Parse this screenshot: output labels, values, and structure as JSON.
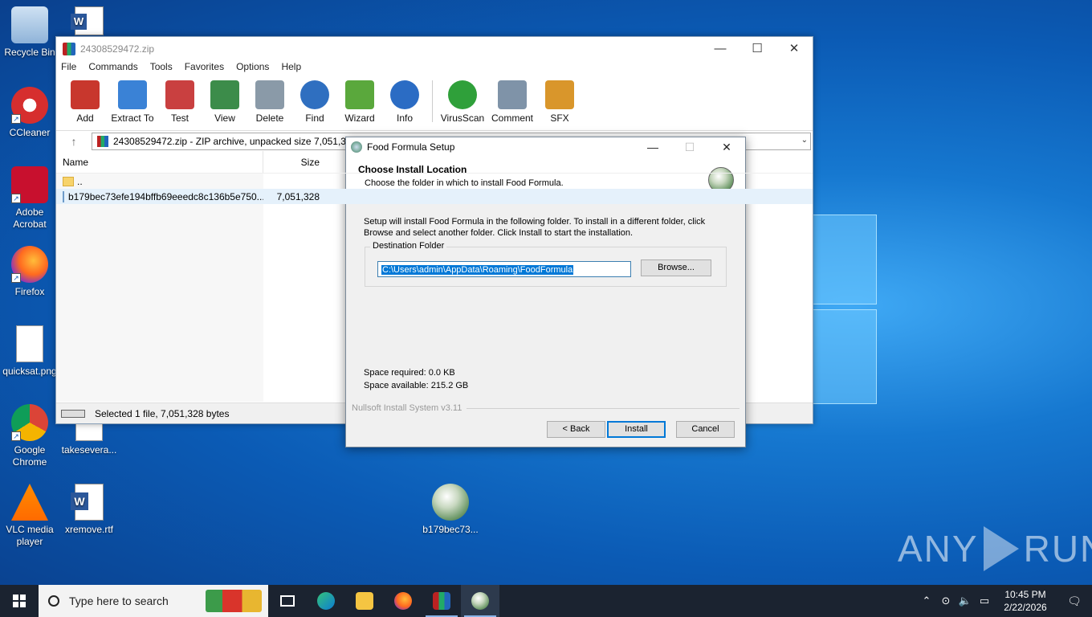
{
  "desktop": {
    "icons": [
      {
        "label": "Recycle Bin",
        "icon": "recycle-bin-icon"
      },
      {
        "label": "CCleaner",
        "icon": "ccleaner-icon"
      },
      {
        "label": "Adobe Acrobat",
        "icon": "acrobat-icon"
      },
      {
        "label": "Firefox",
        "icon": "firefox-icon"
      },
      {
        "label": "quicksat.png",
        "icon": "image-file-icon"
      },
      {
        "label": "Google Chrome",
        "icon": "chrome-icon"
      },
      {
        "label": "VLC media player",
        "icon": "vlc-icon"
      },
      {
        "label": "takesevera...",
        "icon": "image-file-icon"
      },
      {
        "label": "xremove.rtf",
        "icon": "word-document-icon"
      },
      {
        "label": "b179bec73...",
        "icon": "nsis-installer-icon"
      }
    ]
  },
  "winrar": {
    "title": "24308529472.zip",
    "menu": [
      "File",
      "Commands",
      "Tools",
      "Favorites",
      "Options",
      "Help"
    ],
    "toolbar": [
      {
        "label": "Add",
        "color": "#c8372d"
      },
      {
        "label": "Extract To",
        "color": "#3a82d6"
      },
      {
        "label": "Test",
        "color": "#c94040"
      },
      {
        "label": "View",
        "color": "#3c8c4a"
      },
      {
        "label": "Delete",
        "color": "#8a9aa8"
      },
      {
        "label": "Find",
        "color": "#2f6fc0"
      },
      {
        "label": "Wizard",
        "color": "#5aa83c"
      },
      {
        "label": "Info",
        "color": "#2b6cc4"
      },
      {
        "label": "VirusScan",
        "color": "#2fa03a"
      },
      {
        "label": "Comment",
        "color": "#7f93a8"
      },
      {
        "label": "SFX",
        "color": "#d9962b"
      }
    ],
    "path": "24308529472.zip - ZIP archive, unpacked size 7,051,328",
    "columns": {
      "name": "Name",
      "size": "Size"
    },
    "rows": [
      {
        "name": "..",
        "size": ""
      },
      {
        "name": "b179bec73efe194bffb69eeedc8c136b5e750...",
        "size": "7,051,328"
      }
    ],
    "status": "Selected 1 file, 7,051,328 bytes"
  },
  "setup": {
    "title": "Food Formula Setup",
    "heading": "Choose Install Location",
    "subheading": "Choose the folder in which to install Food Formula.",
    "description": "Setup will install Food Formula in the following folder. To install in a different folder, click Browse and select another folder. Click Install to start the installation.",
    "dest_label": "Destination Folder",
    "dest_path": "C:\\Users\\admin\\AppData\\Roaming\\FoodFormula",
    "browse": "Browse...",
    "space_required": "Space required: 0.0 KB",
    "space_available": "Space available: 215.2 GB",
    "branding": "Nullsoft Install System v3.11",
    "back": "< Back",
    "install": "Install",
    "cancel": "Cancel"
  },
  "taskbar": {
    "search_placeholder": "Type here to search",
    "time": "10:45 PM",
    "date": "2/22/2026"
  },
  "watermark": {
    "left": "ANY",
    "right": "RUN"
  }
}
